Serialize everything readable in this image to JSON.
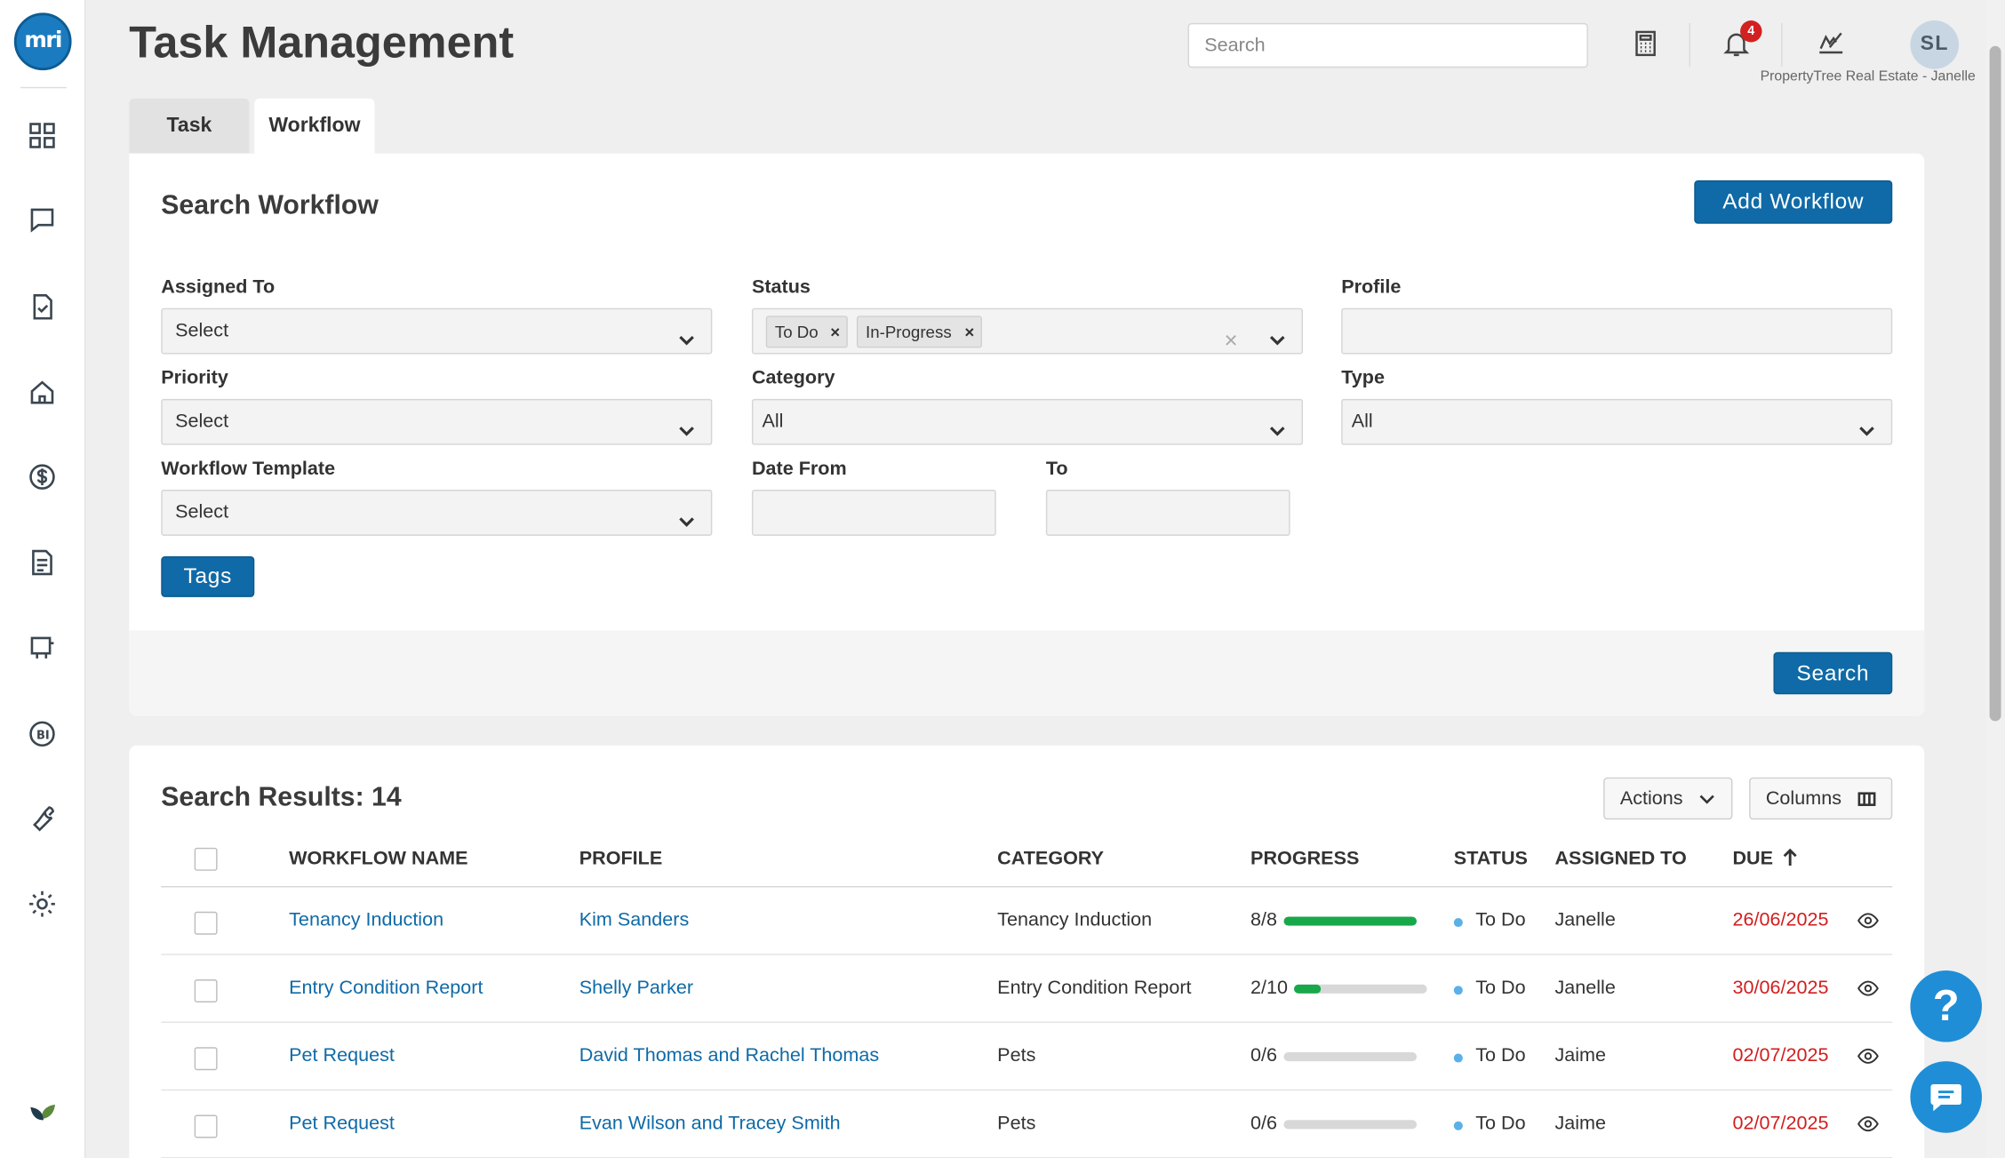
{
  "header": {
    "title": "Task Management",
    "search_placeholder": "Search",
    "notification_count": "4",
    "avatar_initials": "SL",
    "account_name": "PropertyTree Real Estate - Janelle"
  },
  "logo_text": "mri",
  "sidebar": {
    "icons": [
      "dashboard-icon",
      "chat-icon",
      "checklist-icon",
      "property-icon",
      "dollar-icon",
      "document-icon",
      "sign-icon",
      "bi-icon",
      "wrench-icon",
      "gear-icon",
      "leaf-icon"
    ]
  },
  "tabs": [
    {
      "label": "Task",
      "active": false
    },
    {
      "label": "Workflow",
      "active": true
    }
  ],
  "search_panel": {
    "title": "Search Workflow",
    "add_button": "Add Workflow",
    "assigned_to": {
      "label": "Assigned To",
      "value": "Select"
    },
    "status": {
      "label": "Status",
      "chips": [
        "To Do",
        "In-Progress"
      ]
    },
    "profile": {
      "label": "Profile",
      "value": ""
    },
    "priority": {
      "label": "Priority",
      "value": "Select"
    },
    "category": {
      "label": "Category",
      "value": "All"
    },
    "type": {
      "label": "Type",
      "value": "All"
    },
    "workflow_template": {
      "label": "Workflow Template",
      "value": "Select"
    },
    "date_from": {
      "label": "Date From",
      "value": ""
    },
    "date_to": {
      "label": "To",
      "value": ""
    },
    "tags_button": "Tags",
    "search_button": "Search"
  },
  "results": {
    "title": "Search Results: 14",
    "actions_button": "Actions",
    "columns_button": "Columns",
    "columns": [
      "WORKFLOW NAME",
      "PROFILE",
      "CATEGORY",
      "PROGRESS",
      "STATUS",
      "ASSIGNED TO",
      "DUE"
    ],
    "rows": [
      {
        "name": "Tenancy Induction",
        "profile": "Kim Sanders",
        "category": "Tenancy Induction",
        "progress": "8/8",
        "progress_pct": 100,
        "status": "To Do",
        "assigned": "Janelle",
        "due": "26/06/2025"
      },
      {
        "name": "Entry Condition Report",
        "profile": "Shelly Parker",
        "category": "Entry Condition Report",
        "progress": "2/10",
        "progress_pct": 20,
        "status": "To Do",
        "assigned": "Janelle",
        "due": "30/06/2025"
      },
      {
        "name": "Pet Request",
        "profile": "David Thomas and Rachel Thomas",
        "category": "Pets",
        "progress": "0/6",
        "progress_pct": 0,
        "status": "To Do",
        "assigned": "Jaime",
        "due": "02/07/2025"
      },
      {
        "name": "Pet Request",
        "profile": "Evan Wilson and Tracey Smith",
        "category": "Pets",
        "progress": "0/6",
        "progress_pct": 0,
        "status": "To Do",
        "assigned": "Jaime",
        "due": "02/07/2025"
      }
    ]
  },
  "help_label": "?",
  "colors": {
    "primary": "#0f6aa7",
    "due": "#d11e1e",
    "progress": "#18a84a",
    "status_dot": "#5ab0e8"
  }
}
